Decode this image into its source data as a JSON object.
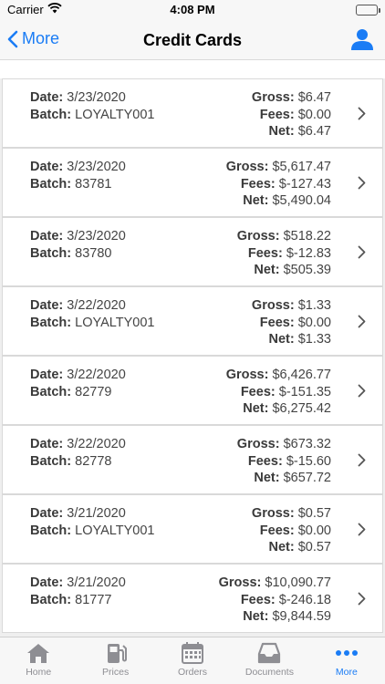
{
  "status_bar": {
    "carrier": "Carrier",
    "time": "4:08 PM"
  },
  "nav": {
    "back_label": "More",
    "title": "Credit Cards"
  },
  "batches": [
    {
      "date": "3/23/2020",
      "batch": "LOYALTY001",
      "gross": "$6.47",
      "fees": "$0.00",
      "net": "$6.47"
    },
    {
      "date": "3/23/2020",
      "batch": "83781",
      "gross": "$5,617.47",
      "fees": "$-127.43",
      "net": "$5,490.04"
    },
    {
      "date": "3/23/2020",
      "batch": "83780",
      "gross": "$518.22",
      "fees": "$-12.83",
      "net": "$505.39"
    },
    {
      "date": "3/22/2020",
      "batch": "LOYALTY001",
      "gross": "$1.33",
      "fees": "$0.00",
      "net": "$1.33"
    },
    {
      "date": "3/22/2020",
      "batch": "82779",
      "gross": "$6,426.77",
      "fees": "$-151.35",
      "net": "$6,275.42"
    },
    {
      "date": "3/22/2020",
      "batch": "82778",
      "gross": "$673.32",
      "fees": "$-15.60",
      "net": "$657.72"
    },
    {
      "date": "3/21/2020",
      "batch": "LOYALTY001",
      "gross": "$0.57",
      "fees": "$0.00",
      "net": "$0.57"
    },
    {
      "date": "3/21/2020",
      "batch": "81777",
      "gross": "$10,090.77",
      "fees": "$-246.18",
      "net": "$9,844.59"
    }
  ],
  "labels": {
    "date": "Date:",
    "batch": "Batch:",
    "gross": "Gross:",
    "fees": "Fees:",
    "net": "Net:"
  },
  "tabs": [
    {
      "label": "Home",
      "icon": "home-icon"
    },
    {
      "label": "Prices",
      "icon": "fuel-pump-icon"
    },
    {
      "label": "Orders",
      "icon": "calendar-icon"
    },
    {
      "label": "Documents",
      "icon": "inbox-icon"
    },
    {
      "label": "More",
      "icon": "more-dots-icon"
    }
  ],
  "active_tab": "More",
  "colors": {
    "accent": "#1a7cf5",
    "inactive": "#8e8e93",
    "battery": "#35c759"
  }
}
